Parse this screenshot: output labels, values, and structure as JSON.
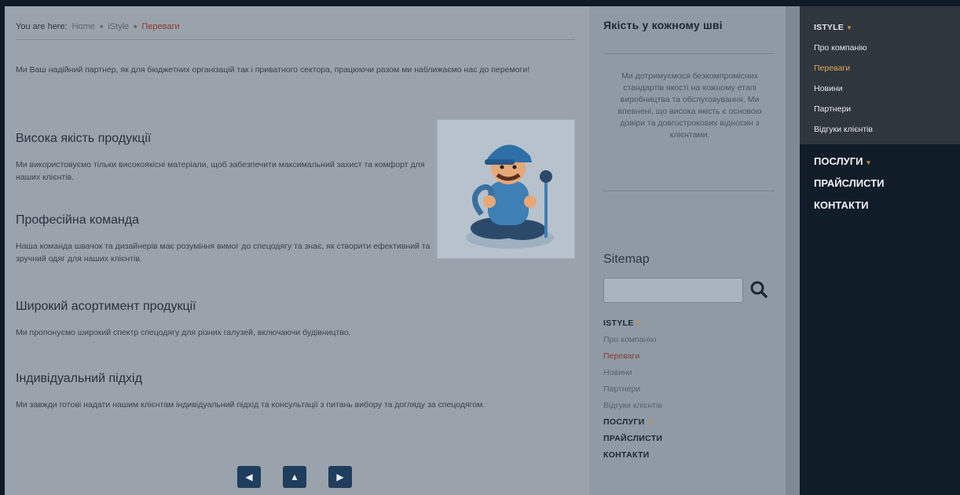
{
  "breadcrumb": {
    "prefix": "You are here:",
    "items": [
      "Home",
      "iStyle",
      "Переваги"
    ]
  },
  "intro": "Ми Ваш надійний партнер, як для бюджетних організацій так і приватного сектора, працюючи разом ми наближаємо нас до перемоги!",
  "sections": [
    {
      "title": "Висока якість продукції",
      "text": "Ми використовуємо тільки високоякісні матеріали, щоб забезпечити максимальний захист та комфорт для наших клієнтів."
    },
    {
      "title": "Професійна команда",
      "text": "Наша команда швачок та дизайнерів має розуміння вимог до спецодягу та знає, як створити ефективний та зручний одяг для наших клієнтів."
    },
    {
      "title": "Широкий асортимент продукції",
      "text": "Ми пропонуємо широкий спектр спецодягу для різних галузей, включаючи будівництво."
    },
    {
      "title": "Індивідуальний підхід",
      "text": "Ми завжди готові надати нашим клієнтам індивідуальний підхід та консультації з питань вибору та догляду за спецодягом."
    }
  ],
  "pager": {
    "prev": "◀",
    "up": "▲",
    "next": "▶"
  },
  "quality": {
    "title": "Якість у кожному шві",
    "text": "Ми дотримуємося безкомпромісних стандартів якості на кожному етапі виробництва та обслуговування. Ми впевнені, що висока якість є основою довіри та довгострокових відносин з клієнтами."
  },
  "sitemap": {
    "title": "Sitemap",
    "search_placeholder": "",
    "items": [
      {
        "label": "ISTYLE",
        "bold": true,
        "caret": true
      },
      {
        "label": "Про компанію"
      },
      {
        "label": "Переваги",
        "current": true
      },
      {
        "label": "Новини"
      },
      {
        "label": "Партнери"
      },
      {
        "label": "Відгуки клієнтів"
      },
      {
        "label": "ПОСЛУГИ",
        "bold": true,
        "caret": true
      },
      {
        "label": "ПРАЙСЛИСТИ",
        "bold": true
      },
      {
        "label": "КОНТАКТИ",
        "bold": true
      }
    ]
  },
  "rightnav": {
    "top_title": "ISTYLE",
    "sub": [
      "Про компанію",
      "Переваги",
      "Новини",
      "Партнери",
      "Відгуки клієнтів"
    ],
    "active_index": 1,
    "main": [
      "ПОСЛУГИ",
      "ПРАЙСЛИСТИ",
      "КОНТАКТИ"
    ]
  },
  "colors": {
    "accent": "#e0a84f",
    "current_link": "#8c3a2a",
    "nav_bg": "#111c29",
    "button": "#1f3d5c"
  }
}
